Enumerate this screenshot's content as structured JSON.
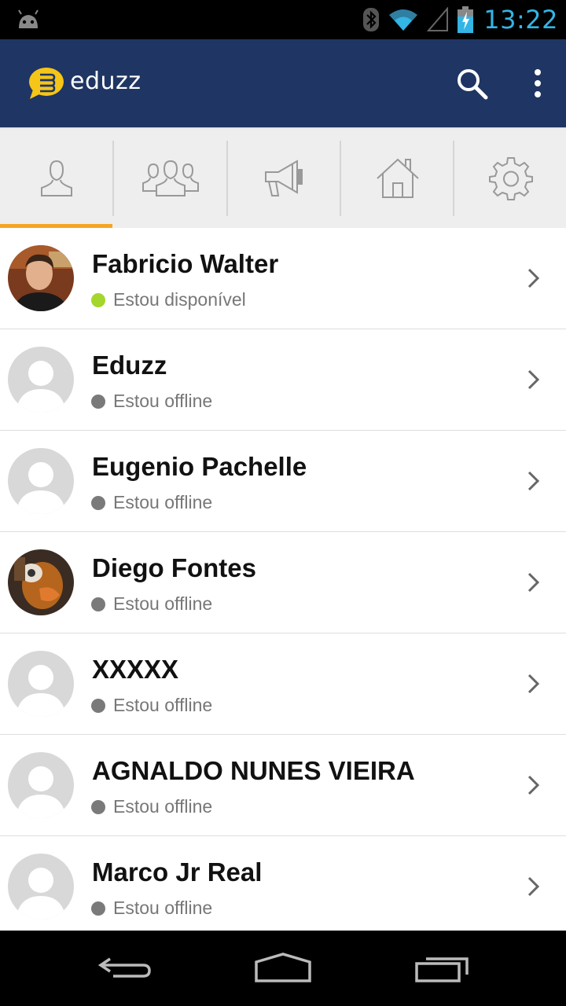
{
  "status_bar": {
    "time": "13:22",
    "icons": [
      "android-icon",
      "bluetooth-icon",
      "wifi-icon",
      "signal-icon",
      "battery-charging-icon"
    ],
    "time_color": "#33b5e5"
  },
  "action_bar": {
    "title": "eduzz",
    "background": "#1f3563",
    "logo_color": "#f5c518",
    "icons": [
      "search-icon",
      "overflow-menu-icon"
    ]
  },
  "tabs": [
    {
      "name": "contacts",
      "icon": "person-icon",
      "selected": true
    },
    {
      "name": "groups",
      "icon": "group-icon",
      "selected": false
    },
    {
      "name": "broadcast",
      "icon": "megaphone-icon",
      "selected": false
    },
    {
      "name": "home",
      "icon": "home-icon",
      "selected": false
    },
    {
      "name": "settings",
      "icon": "gear-icon",
      "selected": false
    }
  ],
  "tab_indicator_color": "#f5a524",
  "contacts": [
    {
      "name": "Fabricio Walter",
      "status": "Estou disponível",
      "online": true,
      "avatar": "photo"
    },
    {
      "name": "Eduzz",
      "status": "Estou offline",
      "online": false,
      "avatar": "placeholder"
    },
    {
      "name": "Eugenio Pachelle",
      "status": "Estou offline",
      "online": false,
      "avatar": "placeholder"
    },
    {
      "name": "Diego Fontes",
      "status": "Estou offline",
      "online": false,
      "avatar": "photo"
    },
    {
      "name": "XXXXX",
      "status": "Estou offline",
      "online": false,
      "avatar": "placeholder"
    },
    {
      "name": "AGNALDO NUNES VIEIRA",
      "status": "Estou offline",
      "online": false,
      "avatar": "placeholder"
    },
    {
      "name": "Marco Jr Real",
      "status": "Estou offline",
      "online": false,
      "avatar": "placeholder"
    }
  ],
  "status_colors": {
    "online": "#a4d62b",
    "offline": "#7a7a7a"
  },
  "nav_bar": {
    "icons": [
      "back-icon",
      "home-nav-icon",
      "recent-apps-icon"
    ]
  }
}
